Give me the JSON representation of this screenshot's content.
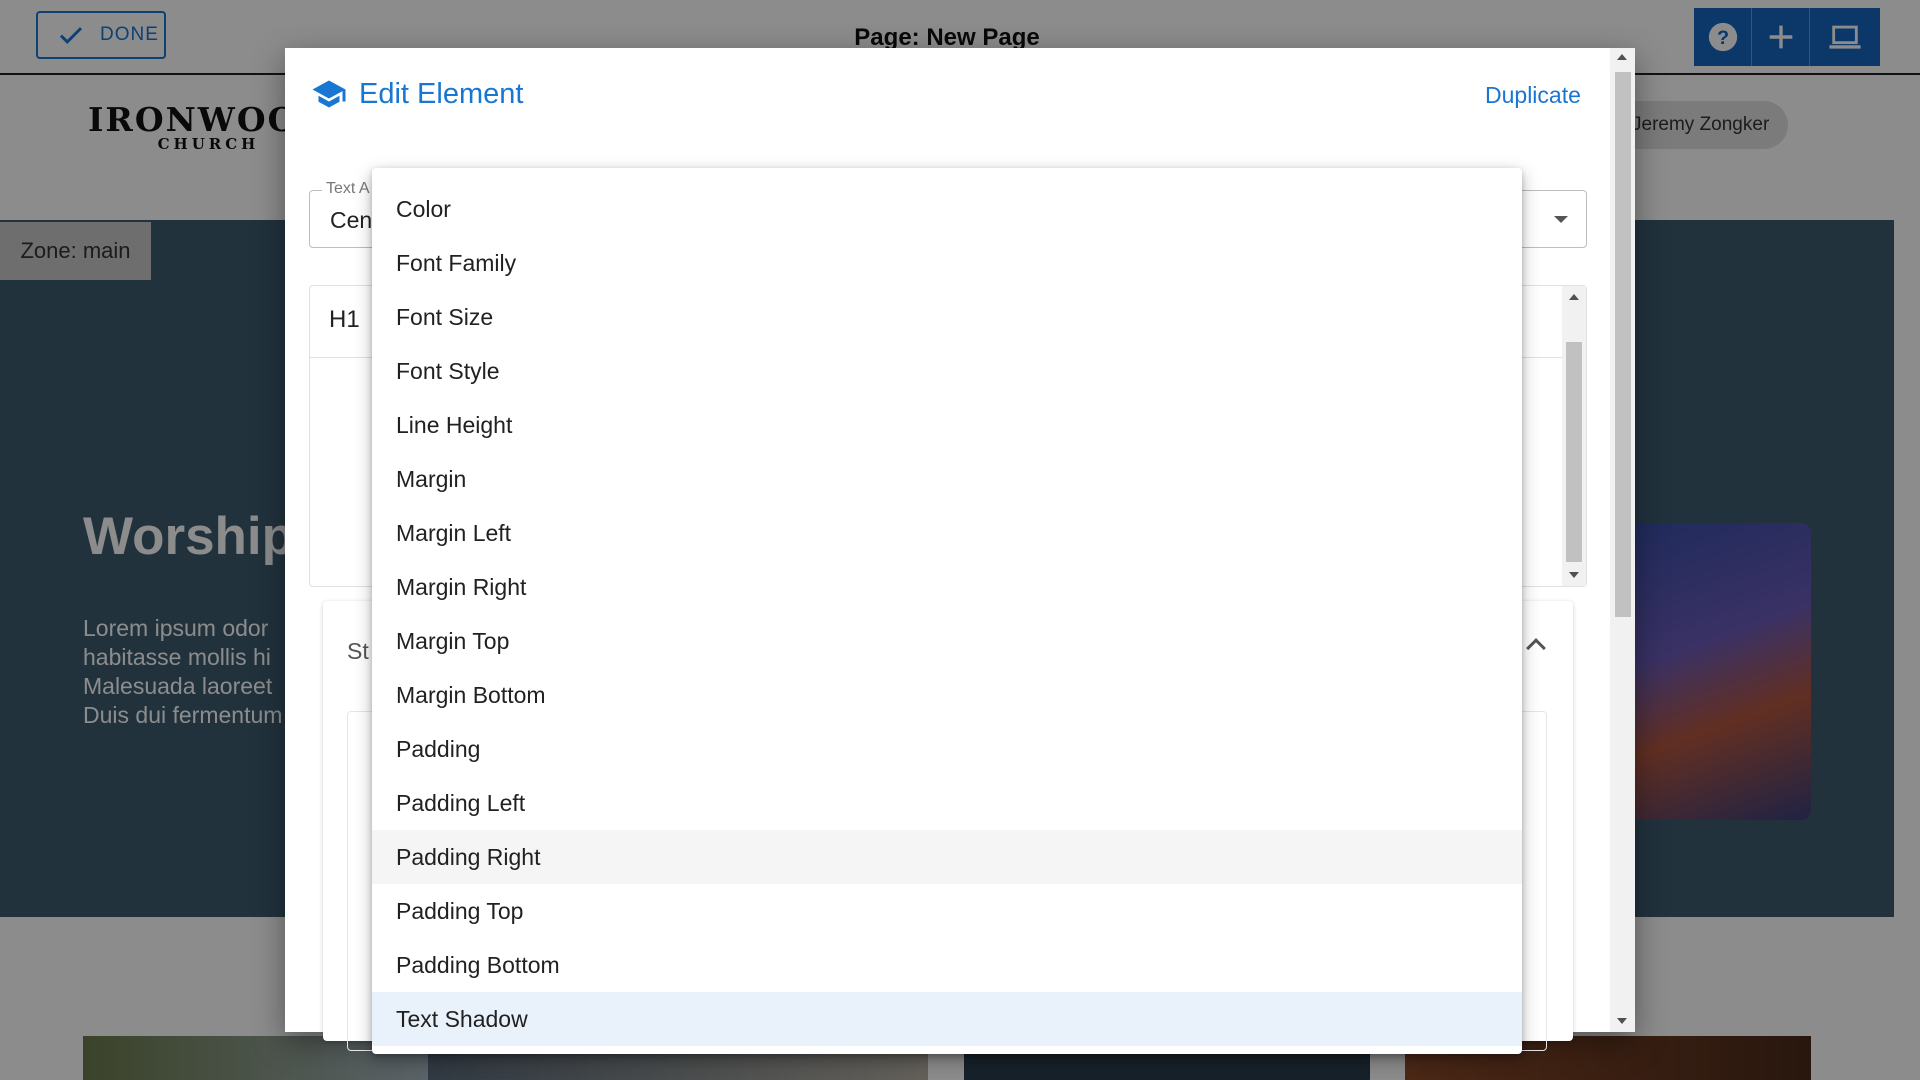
{
  "topbar": {
    "done_label": "DONE",
    "page_title": "Page: New Page",
    "actions": [
      {
        "icon": "help-icon"
      },
      {
        "icon": "plus-icon"
      },
      {
        "icon": "laptop-icon"
      }
    ]
  },
  "site": {
    "logo_main": "IRONWOOD",
    "logo_sub": "CHURCH",
    "user_name": "Jeremy Zongker",
    "zone_label": "Zone: main",
    "hero_title": "Worship",
    "hero_lines": [
      "Lorem ipsum odor",
      "habitasse mollis hi",
      "Malesuada laoreet",
      "Duis dui fermentum"
    ]
  },
  "dialog": {
    "title": "Edit Element",
    "title_icon": "graduation-cap-icon",
    "duplicate_label": "Duplicate",
    "text_align": {
      "label": "Text A",
      "value": "Cen"
    },
    "editor_block_label": "H1",
    "styles_label": "St"
  },
  "menu": {
    "items": [
      {
        "label": "Color"
      },
      {
        "label": "Font Family"
      },
      {
        "label": "Font Size"
      },
      {
        "label": "Font Style"
      },
      {
        "label": "Line Height"
      },
      {
        "label": "Margin"
      },
      {
        "label": "Margin Left"
      },
      {
        "label": "Margin Right"
      },
      {
        "label": "Margin Top"
      },
      {
        "label": "Margin Bottom"
      },
      {
        "label": "Padding"
      },
      {
        "label": "Padding Left"
      },
      {
        "label": "Padding Right",
        "state": "hover"
      },
      {
        "label": "Padding Top"
      },
      {
        "label": "Padding Bottom"
      },
      {
        "label": "Text Shadow",
        "state": "selected"
      }
    ]
  },
  "colors": {
    "accent": "#1976d2",
    "hero_bg": "#3c5b70",
    "hover_bg": "#f5f5f5",
    "selected_bg": "#e9f1fb"
  }
}
